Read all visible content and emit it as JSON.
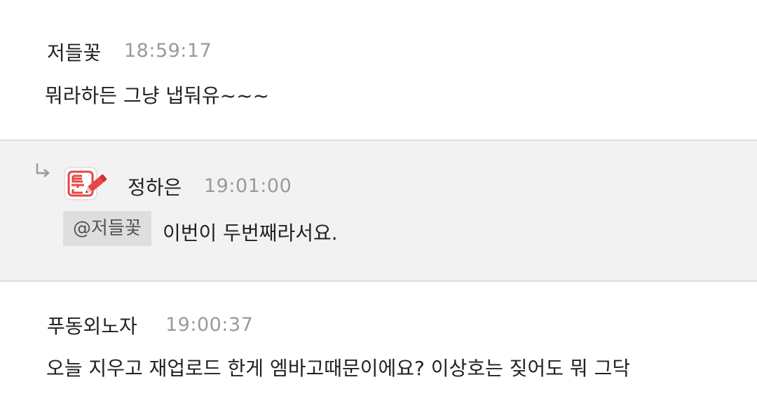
{
  "comments": [
    {
      "author": "저들꽃",
      "time": "18:59:17",
      "text": "뭐라하든 그냥 냅둬유~~~"
    },
    {
      "is_reply": true,
      "badge_icon": "edit-pencil-badge-icon",
      "author": "정하은",
      "time": "19:01:00",
      "mention": "@저들꽃",
      "text": "이번이 두번째라서요."
    },
    {
      "author": "푸동외노자",
      "time": "19:00:37",
      "text": "오늘 지우고 재업로드 한게 엠바고때문이에요? 이상호는 짖어도 뭐 그닥"
    }
  ],
  "colors": {
    "reply_background": "#f2f2f2",
    "timestamp": "#9a9a9a",
    "mention_background": "#dedede",
    "badge_red": "#e84545"
  }
}
